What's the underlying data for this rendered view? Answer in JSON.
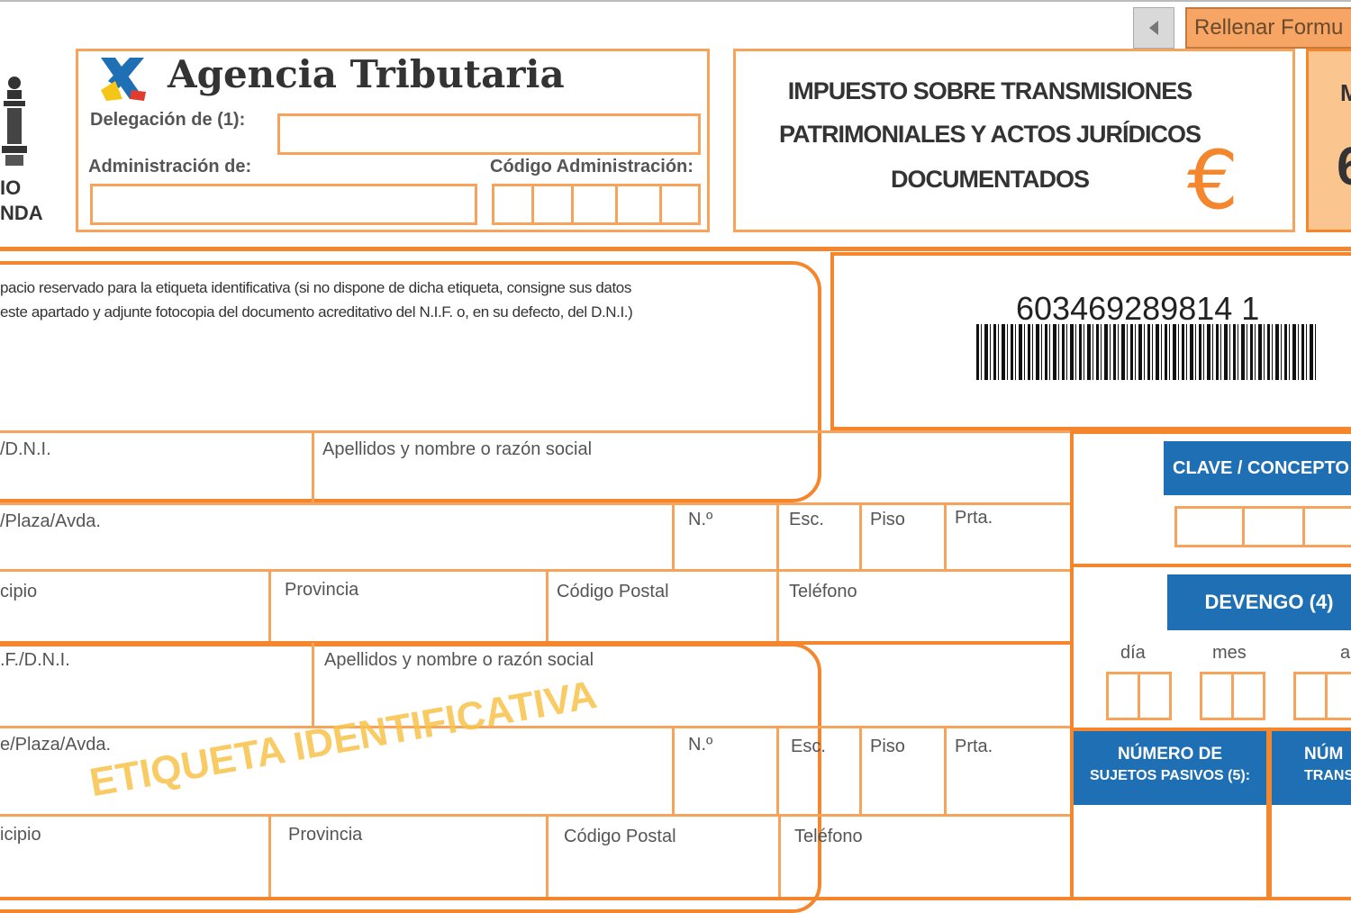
{
  "toolbar": {
    "back_icon": "chevron-left-icon",
    "fill_button": "Rellenar Formu"
  },
  "left_emblem": {
    "icon": "crown-emblem-icon",
    "line1": "IO",
    "line2": "NDA"
  },
  "agency": {
    "logo_icon": "agencia-tributaria-logo-icon",
    "name": "Agencia Tributaria",
    "delegacion_label": "Delegación de (1):",
    "administracion_label": "Administración de:",
    "codigo_admin_label": "Código Administración:"
  },
  "tax_title": {
    "line1": "IMPUESTO SOBRE TRANSMISIONES",
    "line2": "PATRIMONIALES Y ACTOS JURÍDICOS",
    "line3": "DOCUMENTADOS",
    "euro_symbol": "€"
  },
  "corner_box": {
    "top": "M",
    "big": "6"
  },
  "label_area": {
    "text1": "pacio reservado para la etiqueta identificativa (si no dispone de dicha etiqueta, consigne sus datos",
    "text2": "este apartado y adjunte fotocopia del documento acreditativo del N.I.F. o, en su defecto, del D.N.I.)",
    "watermark": "ETIQUETA IDENTIFICATIVA"
  },
  "barcode": {
    "number": "603469289814 1",
    "icon": "barcode-icon"
  },
  "section1": {
    "nif": "/D.N.I.",
    "apellidos": "Apellidos y nombre o razón social",
    "calle": "/Plaza/Avda.",
    "numero": "N.º",
    "esc": "Esc.",
    "piso": "Piso",
    "prta": "Prta.",
    "municipio": "cipio",
    "provincia": "Provincia",
    "cp": "Código Postal",
    "telefono": "Teléfono"
  },
  "section2": {
    "nif": ".F./D.N.I.",
    "apellidos": "Apellidos y nombre o razón social",
    "calle": "e/Plaza/Avda.",
    "numero": "N.º",
    "esc": "Esc.",
    "piso": "Piso",
    "prta": "Prta.",
    "municipio": "icipio",
    "provincia": "Provincia",
    "cp": "Código Postal",
    "telefono": "Teléfono"
  },
  "right_panel": {
    "clave": "CLAVE / CONCEPTO",
    "devengo": "DEVENGO (4)",
    "dia": "día",
    "mes": "mes",
    "anio": "a",
    "num_sujetos_line1": "NÚMERO DE",
    "num_sujetos_line2": "SUJETOS PASIVOS (5):",
    "num_trans_line1": "NÚM",
    "num_trans_line2": "TRANSM"
  },
  "colors": {
    "orange": "#f4872e",
    "light_orange": "#f7a35c",
    "blue": "#1f6fb5",
    "peach": "#fbc58f"
  }
}
